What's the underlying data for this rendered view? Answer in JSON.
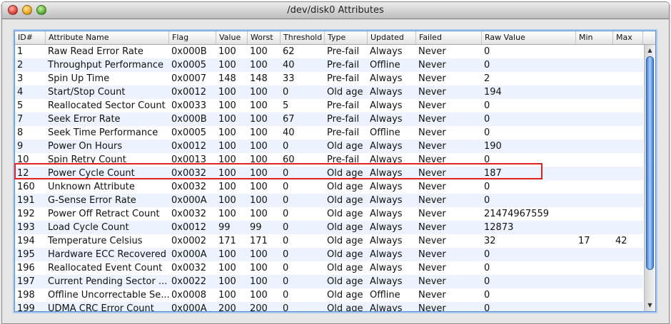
{
  "window": {
    "title": "/dev/disk0 Attributes"
  },
  "table": {
    "columns": [
      "ID#",
      "Attribute Name",
      "Flag",
      "Value",
      "Worst",
      "Threshold",
      "Type",
      "Updated",
      "Failed",
      "Raw Value",
      "Min",
      "Max"
    ],
    "rows": [
      [
        "1",
        "Raw Read Error Rate",
        "0x000B",
        "100",
        "100",
        "62",
        "Pre-fail",
        "Always",
        "Never",
        "0",
        "",
        ""
      ],
      [
        "2",
        "Throughput Performance",
        "0x0005",
        "100",
        "100",
        "40",
        "Pre-fail",
        "Offline",
        "Never",
        "0",
        "",
        ""
      ],
      [
        "3",
        "Spin Up Time",
        "0x0007",
        "148",
        "148",
        "33",
        "Pre-fail",
        "Always",
        "Never",
        "2",
        "",
        ""
      ],
      [
        "4",
        "Start/Stop Count",
        "0x0012",
        "100",
        "100",
        "0",
        "Old age",
        "Always",
        "Never",
        "194",
        "",
        ""
      ],
      [
        "5",
        "Reallocated Sector Count",
        "0x0033",
        "100",
        "100",
        "5",
        "Pre-fail",
        "Always",
        "Never",
        "0",
        "",
        ""
      ],
      [
        "7",
        "Seek Error Rate",
        "0x000B",
        "100",
        "100",
        "67",
        "Pre-fail",
        "Always",
        "Never",
        "0",
        "",
        ""
      ],
      [
        "8",
        "Seek Time Performance",
        "0x0005",
        "100",
        "100",
        "40",
        "Pre-fail",
        "Offline",
        "Never",
        "0",
        "",
        ""
      ],
      [
        "9",
        "Power On Hours",
        "0x0012",
        "100",
        "100",
        "0",
        "Old age",
        "Always",
        "Never",
        "190",
        "",
        ""
      ],
      [
        "10",
        "Spin Retry Count",
        "0x0013",
        "100",
        "100",
        "60",
        "Pre-fail",
        "Always",
        "Never",
        "0",
        "",
        ""
      ],
      [
        "12",
        "Power Cycle Count",
        "0x0032",
        "100",
        "100",
        "0",
        "Old age",
        "Always",
        "Never",
        "187",
        "",
        ""
      ],
      [
        "160",
        "Unknown Attribute",
        "0x0032",
        "100",
        "100",
        "0",
        "Old age",
        "Always",
        "Never",
        "0",
        "",
        ""
      ],
      [
        "191",
        "G-Sense Error Rate",
        "0x000A",
        "100",
        "100",
        "0",
        "Old age",
        "Always",
        "Never",
        "0",
        "",
        ""
      ],
      [
        "192",
        "Power Off Retract Count",
        "0x0032",
        "100",
        "100",
        "0",
        "Old age",
        "Always",
        "Never",
        "21474967559",
        "",
        ""
      ],
      [
        "193",
        "Load Cycle Count",
        "0x0012",
        "99",
        "99",
        "0",
        "Old age",
        "Always",
        "Never",
        "12873",
        "",
        ""
      ],
      [
        "194",
        "Temperature Celsius",
        "0x0002",
        "171",
        "171",
        "0",
        "Old age",
        "Always",
        "Never",
        "32",
        "17",
        "42"
      ],
      [
        "195",
        "Hardware ECC Recovered",
        "0x000A",
        "100",
        "100",
        "0",
        "Old age",
        "Always",
        "Never",
        "0",
        "",
        ""
      ],
      [
        "196",
        "Reallocated Event Count",
        "0x0032",
        "100",
        "100",
        "0",
        "Old age",
        "Always",
        "Never",
        "0",
        "",
        ""
      ],
      [
        "197",
        "Current Pending Sector ...",
        "0x0022",
        "100",
        "100",
        "0",
        "Old age",
        "Always",
        "Never",
        "0",
        "",
        ""
      ],
      [
        "198",
        "Offline Uncorrectable Se...",
        "0x0008",
        "100",
        "100",
        "0",
        "Old age",
        "Offline",
        "Never",
        "0",
        "",
        ""
      ],
      [
        "199",
        "UDMA CRC Error Count",
        "0x000A",
        "200",
        "200",
        "0",
        "Old age",
        "Always",
        "Never",
        "0",
        "",
        ""
      ]
    ],
    "highlighted_row_id": "12"
  },
  "colors": {
    "highlight_border": "#e2211c",
    "selection_focus": "#5a8fd0",
    "row_alt": "#edf3fe"
  }
}
